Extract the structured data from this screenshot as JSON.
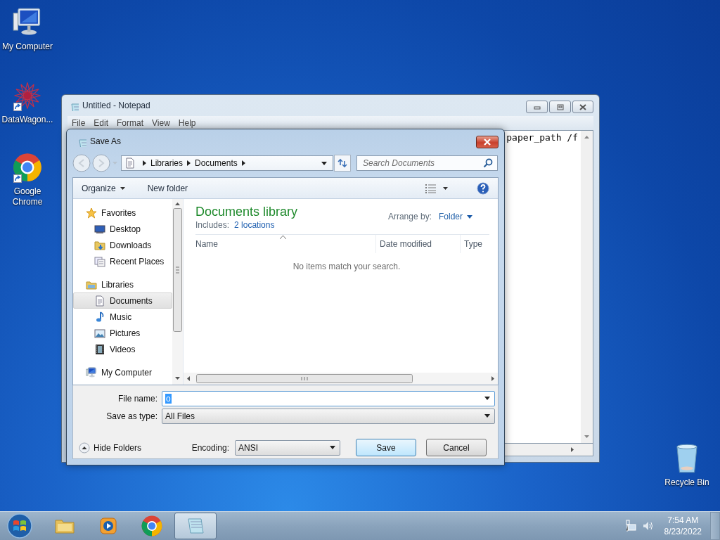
{
  "desktop_icons": [
    {
      "label": "My Computer",
      "kind": "computer",
      "shortcut": false
    },
    {
      "label": "DataWagon...",
      "kind": "network",
      "shortcut": true
    },
    {
      "label": "Google Chrome",
      "kind": "chrome",
      "shortcut": true
    },
    {
      "label": "Recycle Bin",
      "kind": "recycle",
      "shortcut": false
    }
  ],
  "notepad": {
    "title": "Untitled - Notepad",
    "menu": [
      "File",
      "Edit",
      "Format",
      "View",
      "Help"
    ],
    "text": "paper_path /f"
  },
  "save_dialog": {
    "title": "Save As",
    "breadcrumb": [
      "Libraries",
      "Documents"
    ],
    "search": {
      "placeholder": "Search Documents"
    },
    "toolbar": {
      "organize": "Organize",
      "new_folder": "New folder"
    },
    "nav": [
      {
        "label": "Favorites",
        "kind": "favorites",
        "selected": false,
        "children": [
          {
            "label": "Desktop",
            "kind": "desktop",
            "selected": false
          },
          {
            "label": "Downloads",
            "kind": "downloads",
            "selected": false
          },
          {
            "label": "Recent Places",
            "kind": "recent",
            "selected": false
          }
        ]
      },
      {
        "label": "Libraries",
        "kind": "libraries",
        "selected": false,
        "children": [
          {
            "label": "Documents",
            "kind": "documents",
            "selected": true
          },
          {
            "label": "Music",
            "kind": "music",
            "selected": false
          },
          {
            "label": "Pictures",
            "kind": "pictures",
            "selected": false
          },
          {
            "label": "Videos",
            "kind": "videos",
            "selected": false
          }
        ]
      },
      {
        "label": "My Computer",
        "kind": "computer",
        "selected": false
      }
    ],
    "library": {
      "title": "Documents library",
      "includes_label": "Includes:",
      "includes_link": "2 locations",
      "arrange_label": "Arrange by:",
      "arrange_value": "Folder"
    },
    "columns": [
      "Name",
      "Date modified",
      "Type"
    ],
    "empty_message": "No items match your search.",
    "file_name": {
      "label": "File name:",
      "value": "o",
      "value_selected": true
    },
    "save_as_type": {
      "label": "Save as type:",
      "value": "All Files"
    },
    "hide_folders": "Hide Folders",
    "encoding": {
      "label": "Encoding:",
      "value": "ANSI"
    },
    "buttons": [
      {
        "label": "Save",
        "default": true
      },
      {
        "label": "Cancel",
        "default": false
      }
    ]
  },
  "taskbar": {
    "items": [
      {
        "kind": "explorer",
        "active": false
      },
      {
        "kind": "media",
        "active": false
      },
      {
        "kind": "chrome",
        "active": false
      },
      {
        "kind": "notepad",
        "active": true
      }
    ],
    "time": "7:54 AM",
    "date": "8/23/2022"
  }
}
